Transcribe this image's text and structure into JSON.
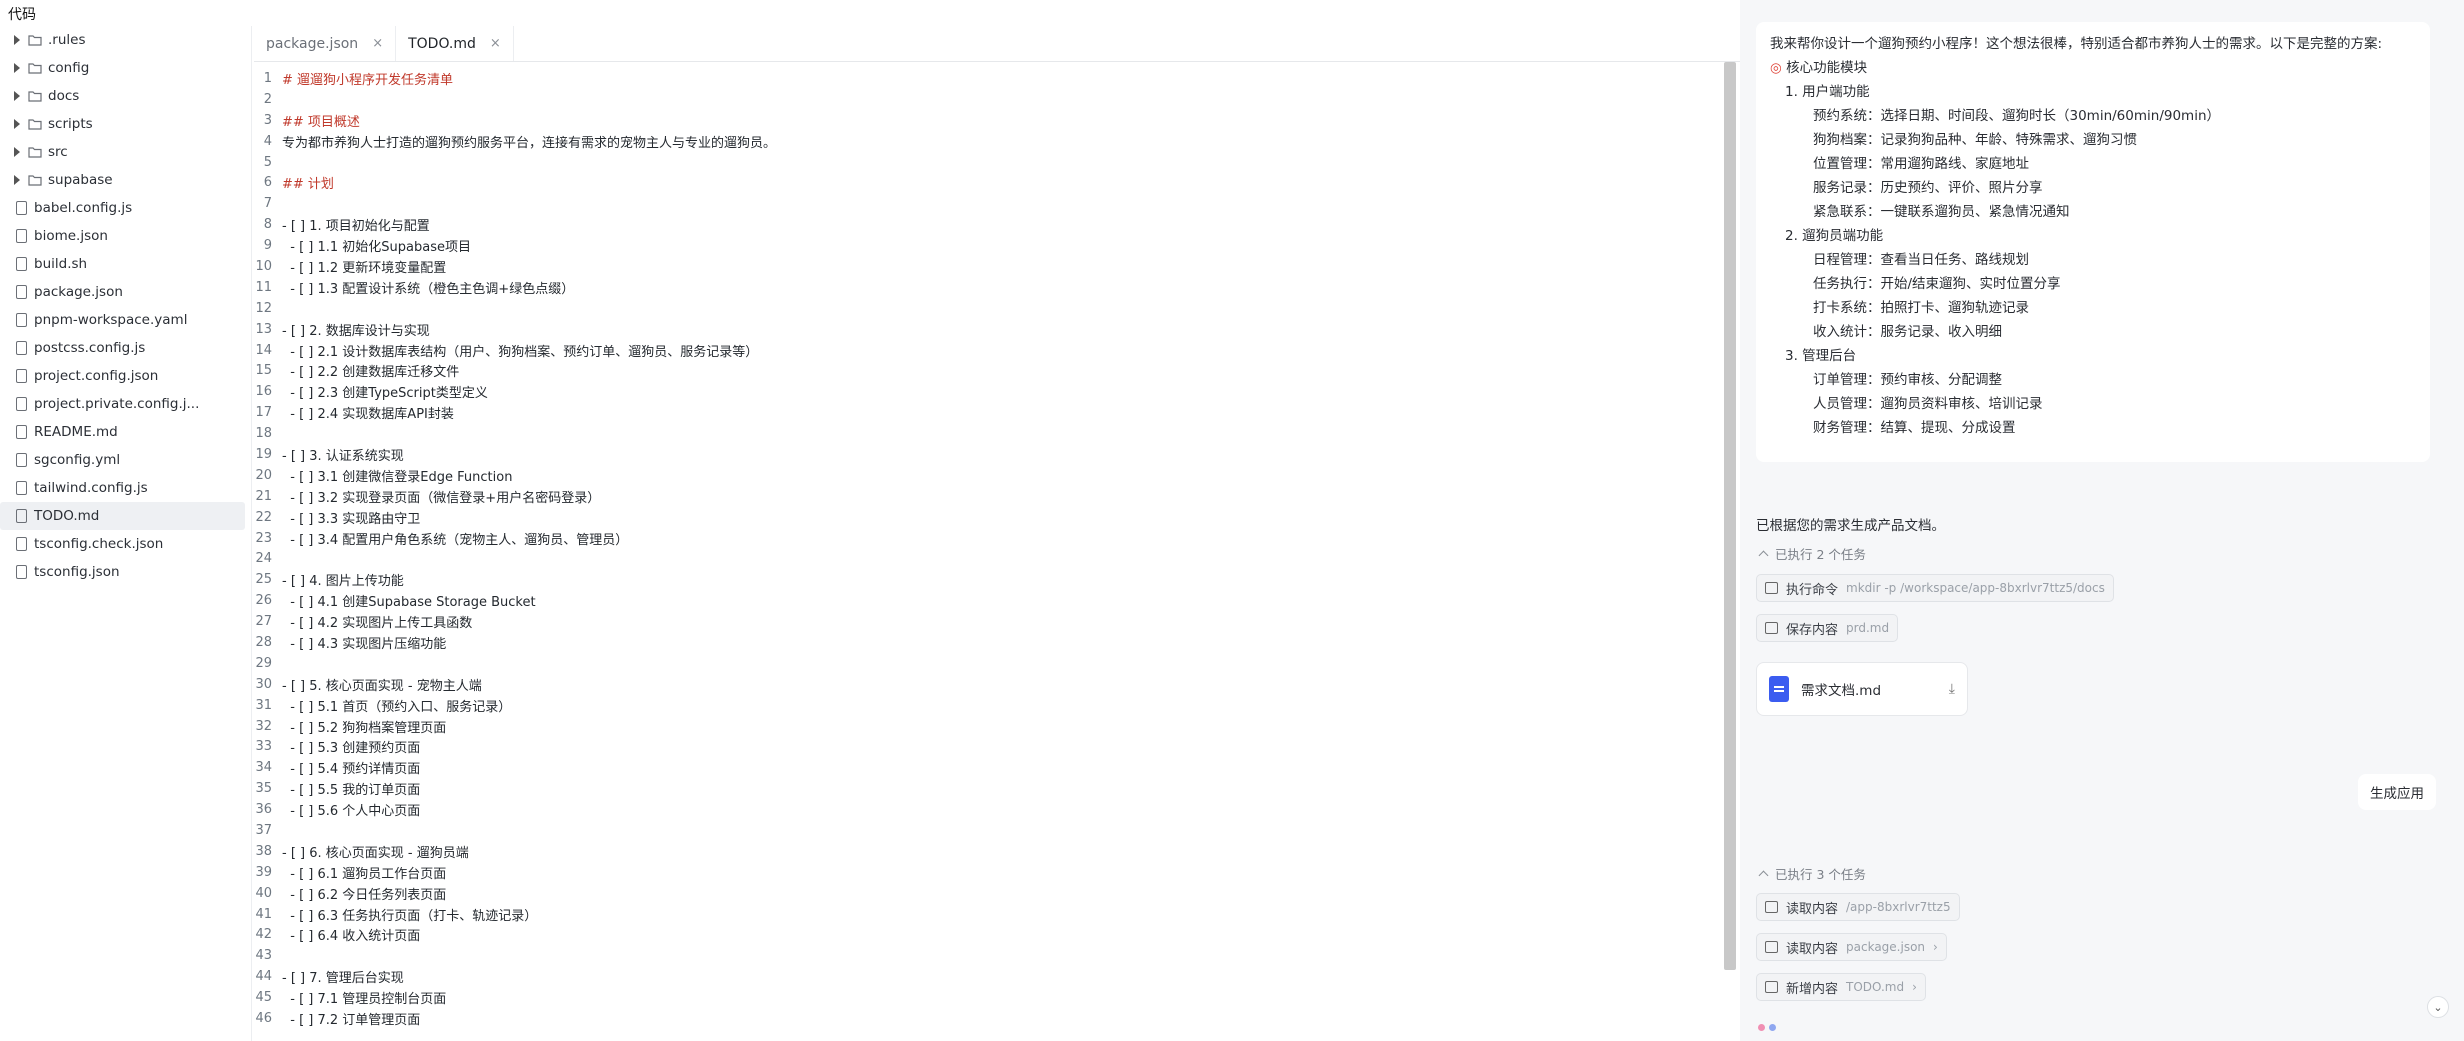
{
  "topbar": {
    "title": "代码"
  },
  "file_tree": {
    "folders": [
      ".rules",
      "config",
      "docs",
      "scripts",
      "src",
      "supabase"
    ],
    "files": [
      "babel.config.js",
      "biome.json",
      "build.sh",
      "package.json",
      "pnpm-workspace.yaml",
      "postcss.config.js",
      "project.config.json",
      "project.private.config.j...",
      "README.md",
      "sgconfig.yml",
      "tailwind.config.js",
      "TODO.md",
      "tsconfig.check.json",
      "tsconfig.json"
    ],
    "active_file": "TODO.md"
  },
  "tabs": [
    {
      "label": "package.json",
      "close": "×",
      "active": false
    },
    {
      "label": "TODO.md",
      "close": "×",
      "active": true
    }
  ],
  "code_lines": [
    {
      "n": "1",
      "t": "# 遛遛狗小程序开发任务清单",
      "h": true
    },
    {
      "n": "2",
      "t": "",
      "h": false
    },
    {
      "n": "3",
      "t": "## 项目概述",
      "h": true
    },
    {
      "n": "4",
      "t": "专为都市养狗人士打造的遛狗预约服务平台，连接有需求的宠物主人与专业的遛狗员。",
      "h": false
    },
    {
      "n": "5",
      "t": "",
      "h": false
    },
    {
      "n": "6",
      "t": "## 计划",
      "h": true
    },
    {
      "n": "7",
      "t": "",
      "h": false
    },
    {
      "n": "8",
      "t": "- [ ] 1. 项目初始化与配置",
      "h": false
    },
    {
      "n": "9",
      "t": "  - [ ] 1.1 初始化Supabase项目",
      "h": false
    },
    {
      "n": "10",
      "t": "  - [ ] 1.2 更新环境变量配置",
      "h": false
    },
    {
      "n": "11",
      "t": "  - [ ] 1.3 配置设计系统（橙色主色调+绿色点缀）",
      "h": false
    },
    {
      "n": "12",
      "t": "",
      "h": false
    },
    {
      "n": "13",
      "t": "- [ ] 2. 数据库设计与实现",
      "h": false
    },
    {
      "n": "14",
      "t": "  - [ ] 2.1 设计数据库表结构（用户、狗狗档案、预约订单、遛狗员、服务记录等）",
      "h": false
    },
    {
      "n": "15",
      "t": "  - [ ] 2.2 创建数据库迁移文件",
      "h": false
    },
    {
      "n": "16",
      "t": "  - [ ] 2.3 创建TypeScript类型定义",
      "h": false
    },
    {
      "n": "17",
      "t": "  - [ ] 2.4 实现数据库API封装",
      "h": false
    },
    {
      "n": "18",
      "t": "",
      "h": false
    },
    {
      "n": "19",
      "t": "- [ ] 3. 认证系统实现",
      "h": false
    },
    {
      "n": "20",
      "t": "  - [ ] 3.1 创建微信登录Edge Function",
      "h": false
    },
    {
      "n": "21",
      "t": "  - [ ] 3.2 实现登录页面（微信登录+用户名密码登录）",
      "h": false
    },
    {
      "n": "22",
      "t": "  - [ ] 3.3 实现路由守卫",
      "h": false
    },
    {
      "n": "23",
      "t": "  - [ ] 3.4 配置用户角色系统（宠物主人、遛狗员、管理员）",
      "h": false
    },
    {
      "n": "24",
      "t": "",
      "h": false
    },
    {
      "n": "25",
      "t": "- [ ] 4. 图片上传功能",
      "h": false
    },
    {
      "n": "26",
      "t": "  - [ ] 4.1 创建Supabase Storage Bucket",
      "h": false
    },
    {
      "n": "27",
      "t": "  - [ ] 4.2 实现图片上传工具函数",
      "h": false
    },
    {
      "n": "28",
      "t": "  - [ ] 4.3 实现图片压缩功能",
      "h": false
    },
    {
      "n": "29",
      "t": "",
      "h": false
    },
    {
      "n": "30",
      "t": "- [ ] 5. 核心页面实现 - 宠物主人端",
      "h": false
    },
    {
      "n": "31",
      "t": "  - [ ] 5.1 首页（预约入口、服务记录）",
      "h": false
    },
    {
      "n": "32",
      "t": "  - [ ] 5.2 狗狗档案管理页面",
      "h": false
    },
    {
      "n": "33",
      "t": "  - [ ] 5.3 创建预约页面",
      "h": false
    },
    {
      "n": "34",
      "t": "  - [ ] 5.4 预约详情页面",
      "h": false
    },
    {
      "n": "35",
      "t": "  - [ ] 5.5 我的订单页面",
      "h": false
    },
    {
      "n": "36",
      "t": "  - [ ] 5.6 个人中心页面",
      "h": false
    },
    {
      "n": "37",
      "t": "",
      "h": false
    },
    {
      "n": "38",
      "t": "- [ ] 6. 核心页面实现 - 遛狗员端",
      "h": false
    },
    {
      "n": "39",
      "t": "  - [ ] 6.1 遛狗员工作台页面",
      "h": false
    },
    {
      "n": "40",
      "t": "  - [ ] 6.2 今日任务列表页面",
      "h": false
    },
    {
      "n": "41",
      "t": "  - [ ] 6.3 任务执行页面（打卡、轨迹记录）",
      "h": false
    },
    {
      "n": "42",
      "t": "  - [ ] 6.4 收入统计页面",
      "h": false
    },
    {
      "n": "43",
      "t": "",
      "h": false
    },
    {
      "n": "44",
      "t": "- [ ] 7. 管理后台实现",
      "h": false
    },
    {
      "n": "45",
      "t": "  - [ ] 7.1 管理员控制台页面",
      "h": false
    },
    {
      "n": "46",
      "t": "  - [ ] 7.2 订单管理页面",
      "h": false
    }
  ],
  "chat": {
    "intro": "我来帮你设计一个遛狗预约小程序！这个想法很棒，特别适合都市养狗人士的需求。以下是完整的方案:",
    "module_title": "核心功能模块",
    "sections": [
      {
        "title": "1. 用户端功能",
        "items": [
          "预约系统：选择日期、时间段、遛狗时长（30min/60min/90min）",
          "狗狗档案：记录狗狗品种、年龄、特殊需求、遛狗习惯",
          "位置管理：常用遛狗路线、家庭地址",
          "服务记录：历史预约、评价、照片分享",
          "紧急联系：一键联系遛狗员、紧急情况通知"
        ]
      },
      {
        "title": "2. 遛狗员端功能",
        "items": [
          "日程管理：查看当日任务、路线规划",
          "任务执行：开始/结束遛狗、实时位置分享",
          "打卡系统：拍照打卡、遛狗轨迹记录",
          "收入统计：服务记录、收入明细"
        ]
      },
      {
        "title": "3. 管理后台",
        "items": [
          "订单管理：预约审核、分配调整",
          "人员管理：遛狗员资料审核、培训记录",
          "财务管理：结算、提现、分成设置"
        ]
      }
    ],
    "doc_msg": "已根据您的需求生成产品文档。",
    "exec1": "已执行 2 个任务",
    "task1_label": "执行命令",
    "task1_sub": "mkdir -p /workspace/app-8bxrlvr7ttz5/docs",
    "task2_label": "保存内容",
    "task2_sub": "prd.md",
    "file_name": "需求文档.md",
    "user_msg": "生成应用",
    "exec2": "已执行 3 个任务",
    "task3_label": "读取内容",
    "task3_sub": "/app-8bxrlvr7ttz5",
    "task4_label": "读取内容",
    "task4_sub": "package.json",
    "task5_label": "新增内容",
    "task5_sub": "TODO.md"
  }
}
